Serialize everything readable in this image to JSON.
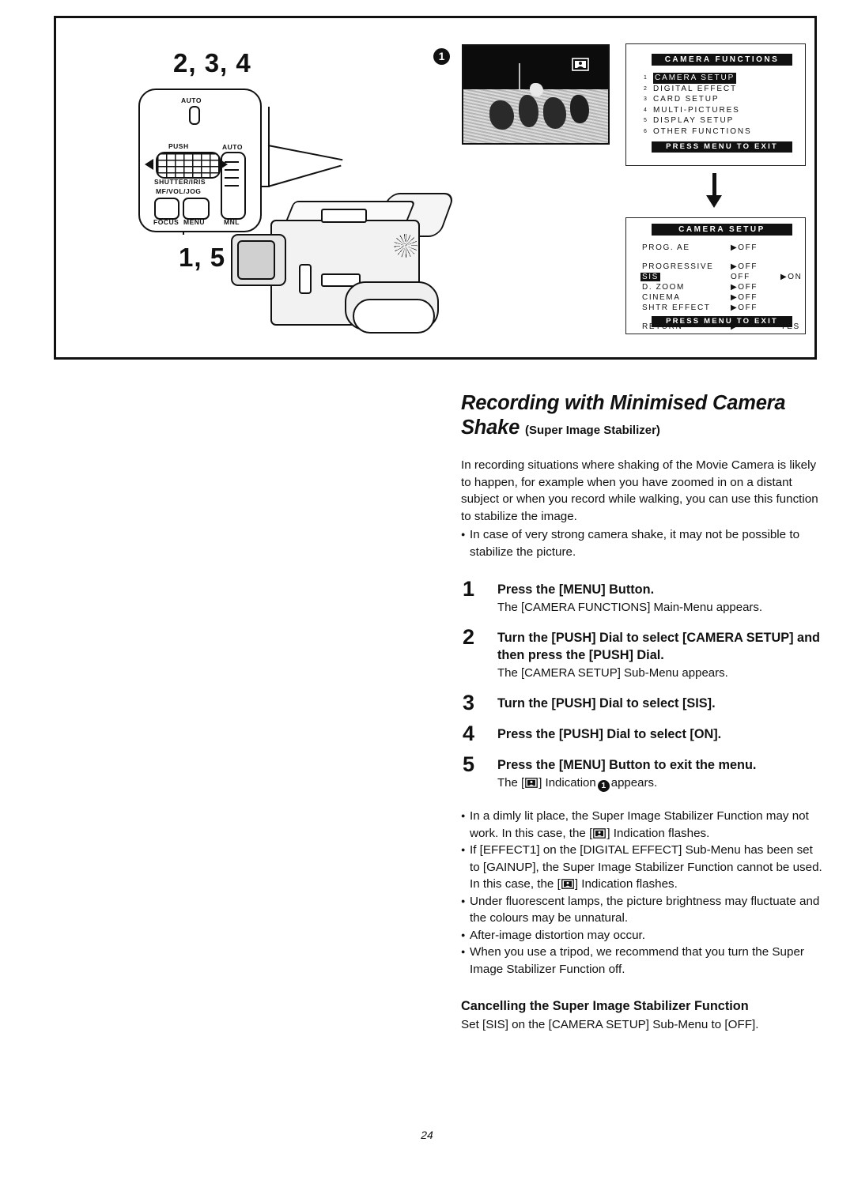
{
  "page_number": "24",
  "illustration": {
    "callout_steps_top": "2, 3, 4",
    "callout_steps_bottom": "1, 5",
    "callout_indicator_1": "1",
    "control_panel": {
      "auto_top_label": "AUTO",
      "push_label": "PUSH",
      "shutter_iris_label": "SHUTTER/IRIS",
      "mf_vol_jog_label": "MF/VOL/JOG",
      "focus_label": "FOCUS",
      "menu_label": "MENU",
      "auto_right_label": "AUTO",
      "mnl_label": "MNL"
    },
    "osd_main_menu": {
      "title": "CAMERA  FUNCTIONS",
      "footer": "PRESS  MENU  TO  EXIT",
      "items": [
        {
          "num": "1",
          "label": "CAMERA  SETUP",
          "selected": true
        },
        {
          "num": "2",
          "label": "DIGITAL  EFFECT",
          "selected": false
        },
        {
          "num": "3",
          "label": "CARD  SETUP",
          "selected": false
        },
        {
          "num": "4",
          "label": "MULTI-PICTURES",
          "selected": false
        },
        {
          "num": "5",
          "label": "DISPLAY  SETUP",
          "selected": false
        },
        {
          "num": "6",
          "label": "OTHER  FUNCTIONS",
          "selected": false
        }
      ]
    },
    "osd_sub_menu": {
      "title": "CAMERA  SETUP",
      "footer": "PRESS  MENU  TO  EXIT",
      "rows": [
        {
          "label": "PROG. AE",
          "value": "▶OFF",
          "value2": "",
          "selected": false,
          "gap_after": true
        },
        {
          "label": "PROGRESSIVE",
          "value": "▶OFF",
          "value2": "",
          "selected": false,
          "gap_after": false
        },
        {
          "label": "SIS",
          "value": "OFF",
          "value2": "▶ON",
          "selected": true,
          "gap_after": false
        },
        {
          "label": "D. ZOOM",
          "value": "▶OFF",
          "value2": "",
          "selected": false,
          "gap_after": false
        },
        {
          "label": "CINEMA",
          "value": "▶OFF",
          "value2": "",
          "selected": false,
          "gap_after": false
        },
        {
          "label": "SHTR  EFFECT",
          "value": "▶OFF",
          "value2": "",
          "selected": false,
          "gap_after": true
        },
        {
          "label": "RETURN",
          "value": "▶  ----",
          "value2": "YES",
          "selected": false,
          "gap_after": false
        }
      ]
    }
  },
  "article": {
    "heading_main": "Recording with Minimised Camera Shake",
    "heading_sub": "(Super Image Stabilizer)",
    "intro_paragraph": "In recording situations where shaking of the Movie Camera is likely to happen, for example when you have zoomed in on a distant subject or when you record while walking, you can use this function to stabilize the image.",
    "intro_bullets": [
      "In case of very strong camera shake, it may not be possible to stabilize the picture."
    ],
    "steps": [
      {
        "num": "1",
        "title": "Press the [MENU] Button.",
        "desc": "The [CAMERA FUNCTIONS] Main-Menu appears.",
        "desc_parts": null
      },
      {
        "num": "2",
        "title": "Turn the [PUSH] Dial to select [CAMERA SETUP] and then press the [PUSH] Dial.",
        "desc": "The [CAMERA SETUP] Sub-Menu appears.",
        "desc_parts": null
      },
      {
        "num": "3",
        "title": "Turn the [PUSH] Dial to select [SIS].",
        "desc": "",
        "desc_parts": null
      },
      {
        "num": "4",
        "title": "Press the [PUSH] Dial to select [ON].",
        "desc": "",
        "desc_parts": null
      },
      {
        "num": "5",
        "title": "Press the [MENU] Button to exit the menu.",
        "desc": "",
        "desc_parts": {
          "before": "The [",
          "middle": "] Indication",
          "badge": "1",
          "after": "appears."
        }
      }
    ],
    "notes": [
      {
        "before": "In a dimly lit place, the Super Image Stabilizer Function may not work. In this case, the [",
        "after": "] Indication flashes."
      },
      {
        "before": "If [EFFECT1] on the [DIGITAL EFFECT] Sub-Menu has been set to [GAINUP], the Super Image Stabilizer Function cannot be used. In this case, the [",
        "after": "] Indication flashes."
      },
      {
        "before": "Under fluorescent lamps, the picture brightness may fluctuate and the colours may be unnatural.",
        "after": ""
      },
      {
        "before": "After-image distortion may occur.",
        "after": ""
      },
      {
        "before": "When you use a tripod, we recommend that you turn the Super Image Stabilizer Function off.",
        "after": ""
      }
    ],
    "cancel_heading": "Cancelling the Super Image Stabilizer Function",
    "cancel_text": "Set [SIS] on the [CAMERA SETUP] Sub-Menu to [OFF]."
  }
}
